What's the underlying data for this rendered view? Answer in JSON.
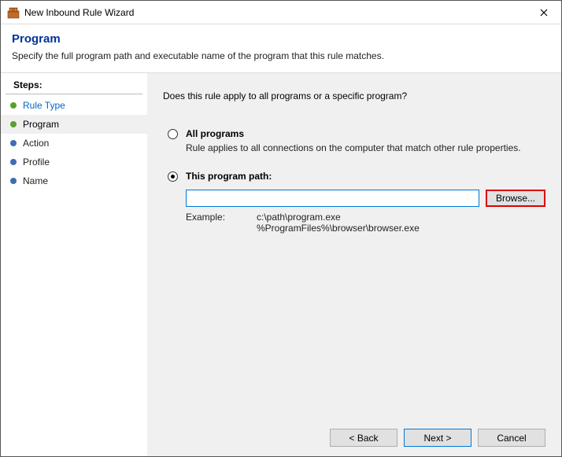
{
  "window": {
    "title": "New Inbound Rule Wizard"
  },
  "header": {
    "title": "Program",
    "subtitle": "Specify the full program path and executable name of the program that this rule matches."
  },
  "sidebar": {
    "title": "Steps:",
    "items": [
      {
        "label": "Rule Type"
      },
      {
        "label": "Program"
      },
      {
        "label": "Action"
      },
      {
        "label": "Profile"
      },
      {
        "label": "Name"
      }
    ]
  },
  "main": {
    "question": "Does this rule apply to all programs or a specific program?",
    "options": {
      "all": {
        "label": "All programs",
        "desc": "Rule applies to all connections on the computer that match other rule properties."
      },
      "this": {
        "label": "This program path:",
        "path_value": "",
        "browse_label": "Browse...",
        "example_label": "Example:",
        "example_values": "c:\\path\\program.exe\n%ProgramFiles%\\browser\\browser.exe"
      }
    }
  },
  "buttons": {
    "back": "< Back",
    "next": "Next >",
    "cancel": "Cancel"
  }
}
